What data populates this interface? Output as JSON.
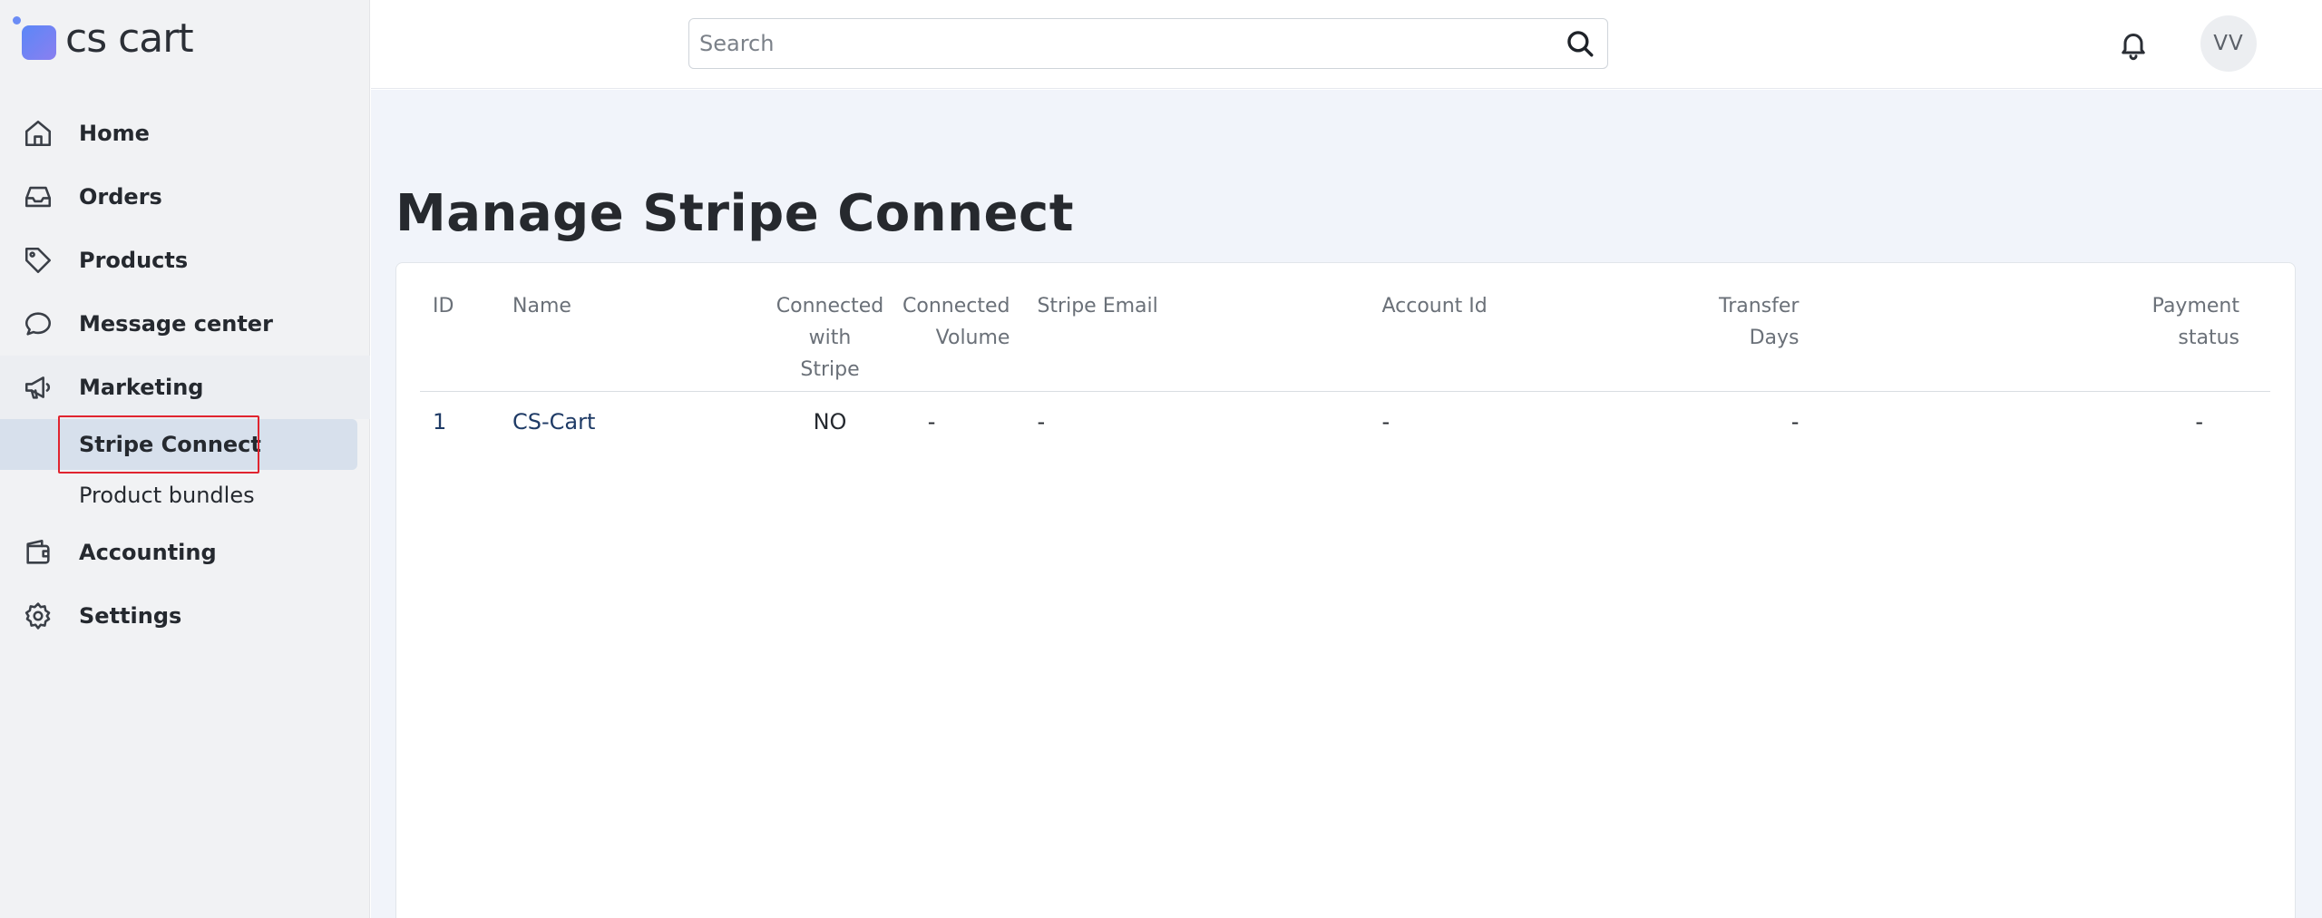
{
  "brand": {
    "logo_text": "cs cart",
    "accent": "#5b87f7"
  },
  "header": {
    "search_placeholder": "Search",
    "avatar_initials": "VV"
  },
  "sidebar": {
    "items": [
      {
        "label": "Home",
        "icon": "home-icon"
      },
      {
        "label": "Orders",
        "icon": "inbox-icon"
      },
      {
        "label": "Products",
        "icon": "tag-icon"
      },
      {
        "label": "Message center",
        "icon": "chat-bubble-icon"
      },
      {
        "label": "Marketing",
        "icon": "megaphone-icon"
      },
      {
        "label": "Accounting",
        "icon": "wallet-icon"
      },
      {
        "label": "Settings",
        "icon": "gear-icon"
      }
    ],
    "marketing_sub": [
      {
        "label": "Stripe Connect",
        "selected": true
      },
      {
        "label": "Product bundles",
        "selected": false
      }
    ]
  },
  "main": {
    "title": "Manage Stripe Connect",
    "table": {
      "headers": {
        "id": "ID",
        "name": "Name",
        "connected_line1": "Connected with",
        "connected_line2": "Stripe",
        "volume_line1": "Connected",
        "volume_line2": "Volume",
        "email": "Stripe Email",
        "account": "Account Id",
        "days_line1": "Transfer",
        "days_line2": "Days",
        "payment_line1": "Payment",
        "payment_line2": "status"
      },
      "rows": [
        {
          "id": "1",
          "name": "CS-Cart",
          "connected": "NO",
          "volume": "-",
          "email": "-",
          "account": "-",
          "days": "-",
          "payment": "-"
        }
      ]
    }
  }
}
